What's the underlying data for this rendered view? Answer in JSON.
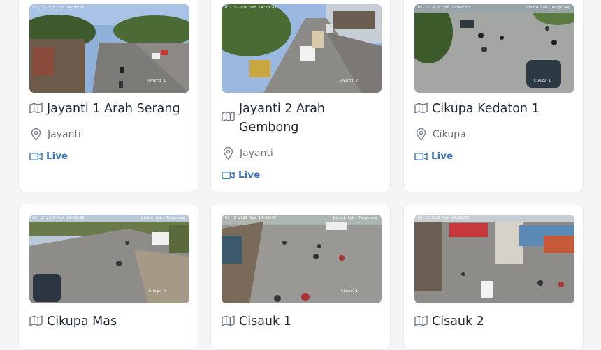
{
  "colors": {
    "accent": "#3b74b8",
    "title": "#1f2933",
    "muted": "#6b7280",
    "background": "#f4f5f7"
  },
  "cameras": [
    {
      "title": "Jayanti 1 Arah Serang",
      "location": "Jayanti",
      "live": "Live",
      "timestamp": "03-15-2026 Sun 14:30:35",
      "overlay_label": "Jayanti 1"
    },
    {
      "title": "Jayanti 2 Arah Gembong",
      "location": "Jayanti",
      "live": "Live",
      "timestamp": "03-15-2026 Sun 14:28:43",
      "overlay_label": "Jayanti 2"
    },
    {
      "title": "Cikupa Kedaton 1",
      "location": "Cikupa",
      "live": "Live",
      "timestamp": "03-15-2026 Sun 12:42:00",
      "overlay_label": "Cikupa 1",
      "caption": "Diskok Kab. Tangerang"
    },
    {
      "title": "Cikupa Mas",
      "timestamp": "03-15-2026 Sun 12:42:00",
      "overlay_label": "Cikupa 2",
      "caption": "Diskok Kab. Tangerang"
    },
    {
      "title": "Cisauk 1",
      "timestamp": "03-15-2026 Sun 14:32:07",
      "overlay_label": "Cisauk 1",
      "caption": "Diskok Kab. Tangerang"
    },
    {
      "title": "Cisauk 2",
      "timestamp": "03-15-2026 Sun 14:32:07",
      "overlay_label": ""
    }
  ],
  "icons": {
    "title": "map-icon",
    "location": "map-pin-icon",
    "live": "video-camera-icon"
  }
}
